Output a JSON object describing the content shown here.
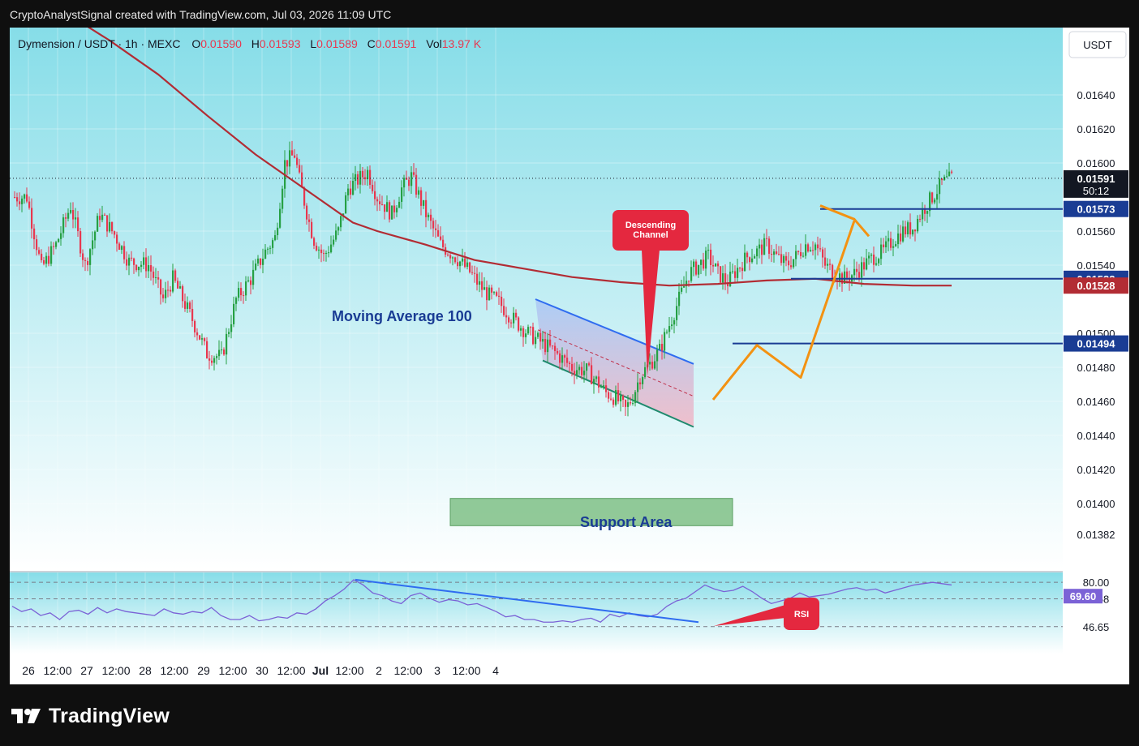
{
  "caption": "CryptoAnalystSignal created with TradingView.com, Jul 03, 2026 11:09 UTC",
  "header": {
    "symbol": "Dymension / USDT · 1h · MEXC",
    "o_label": "O",
    "o_value": "0.01590",
    "h_label": "H",
    "h_value": "0.01593",
    "l_label": "L",
    "l_value": "0.01589",
    "c_label": "C",
    "c_value": "0.01591",
    "vol_label": "Vol",
    "vol_value": "13.97 K"
  },
  "currency_button": "USDT",
  "footer": {
    "brand": "TradingView"
  },
  "colors": {
    "bg_top": "#86dde8",
    "bg_bottom": "#ffffff",
    "up": "#26a044",
    "down": "#e8374f",
    "ma": "#b22c34",
    "level_line": "#1a3c94",
    "orange": "#f39212",
    "channel": "#2f6cf0",
    "channel_fill_top": "#a9c8f6",
    "channel_fill_bottom": "#f2b6c4",
    "support_fill": "#7fbf86",
    "callout": "#e4283f",
    "rsi_line": "#7b62d6"
  },
  "chart_data": {
    "type": "candlestick",
    "pair": "Dymension / USDT",
    "interval": "1h",
    "exchange": "MEXC",
    "price_axis": {
      "min": 0.0137,
      "max": 0.0167,
      "ticks": [
        "0.01640",
        "0.01620",
        "0.01600",
        "0.01560",
        "0.01540",
        "0.01500",
        "0.01480",
        "0.01460",
        "0.01440",
        "0.01420",
        "0.01400",
        "0.01382"
      ]
    },
    "time_axis": {
      "labels": [
        "26",
        "12:00",
        "27",
        "12:00",
        "28",
        "12:00",
        "29",
        "12:00",
        "30",
        "12:00",
        "Jul",
        "12:00",
        "2",
        "12:00",
        "3",
        "12:00",
        "4"
      ],
      "bars_per_label": 12,
      "total_bars": 174
    },
    "close_path": [
      [
        0,
        0.0158
      ],
      [
        6,
        0.0158
      ],
      [
        12,
        0.01538
      ],
      [
        18,
        0.01552
      ],
      [
        24,
        0.01575
      ],
      [
        30,
        0.0154
      ],
      [
        36,
        0.0157
      ],
      [
        42,
        0.01558
      ],
      [
        48,
        0.01542
      ],
      [
        56,
        0.0154
      ],
      [
        62,
        0.0152
      ],
      [
        66,
        0.01532
      ],
      [
        74,
        0.01508
      ],
      [
        80,
        0.01488
      ],
      [
        86,
        0.01486
      ],
      [
        92,
        0.0152
      ],
      [
        98,
        0.01532
      ],
      [
        104,
        0.01548
      ],
      [
        108,
        0.01556
      ],
      [
        112,
        0.016
      ],
      [
        116,
        0.01605
      ],
      [
        118,
        0.0159
      ],
      [
        122,
        0.01565
      ],
      [
        124,
        0.01555
      ],
      [
        128,
        0.01545
      ],
      [
        134,
        0.0156
      ],
      [
        138,
        0.01585
      ],
      [
        142,
        0.0159
      ],
      [
        146,
        0.01595
      ],
      [
        150,
        0.0158
      ],
      [
        156,
        0.0157
      ],
      [
        160,
        0.01585
      ],
      [
        164,
        0.01592
      ],
      [
        170,
        0.0157
      ],
      [
        176,
        0.01552
      ],
      [
        182,
        0.01545
      ],
      [
        188,
        0.01536
      ],
      [
        192,
        0.01528
      ],
      [
        196,
        0.01522
      ],
      [
        200,
        0.01518
      ],
      [
        206,
        0.01508
      ],
      [
        212,
        0.015
      ],
      [
        216,
        0.01496
      ],
      [
        222,
        0.0149
      ],
      [
        226,
        0.01485
      ],
      [
        230,
        0.0148
      ],
      [
        236,
        0.01478
      ],
      [
        240,
        0.01472
      ],
      [
        244,
        0.01465
      ],
      [
        248,
        0.01462
      ],
      [
        252,
        0.01455
      ],
      [
        255,
        0.01463
      ],
      [
        258,
        0.01475
      ],
      [
        262,
        0.01482
      ],
      [
        266,
        0.0149
      ],
      [
        270,
        0.01505
      ],
      [
        274,
        0.0152
      ],
      [
        278,
        0.01535
      ],
      [
        282,
        0.0154
      ],
      [
        286,
        0.01545
      ],
      [
        290,
        0.01535
      ],
      [
        294,
        0.0153
      ],
      [
        298,
        0.01538
      ],
      [
        302,
        0.01545
      ],
      [
        306,
        0.01548
      ],
      [
        310,
        0.01552
      ],
      [
        314,
        0.01545
      ],
      [
        318,
        0.0154
      ],
      [
        322,
        0.01545
      ],
      [
        326,
        0.01552
      ],
      [
        330,
        0.01552
      ],
      [
        334,
        0.0154
      ],
      [
        338,
        0.01535
      ],
      [
        342,
        0.01532
      ],
      [
        346,
        0.01535
      ],
      [
        350,
        0.0154
      ],
      [
        354,
        0.01545
      ],
      [
        358,
        0.01548
      ],
      [
        362,
        0.01555
      ],
      [
        366,
        0.0156
      ],
      [
        370,
        0.01562
      ],
      [
        374,
        0.01572
      ],
      [
        378,
        0.0158
      ],
      [
        382,
        0.01588
      ],
      [
        386,
        0.01591
      ]
    ],
    "moving_average_100_path": [
      [
        0,
        0.01695
      ],
      [
        20,
        0.0169
      ],
      [
        40,
        0.01672
      ],
      [
        60,
        0.01652
      ],
      [
        80,
        0.01628
      ],
      [
        100,
        0.01605
      ],
      [
        120,
        0.01585
      ],
      [
        140,
        0.01565
      ],
      [
        150,
        0.0156
      ],
      [
        170,
        0.01552
      ],
      [
        190,
        0.01543
      ],
      [
        210,
        0.01538
      ],
      [
        230,
        0.01533
      ],
      [
        250,
        0.0153
      ],
      [
        270,
        0.01528
      ],
      [
        290,
        0.01529
      ],
      [
        310,
        0.01531
      ],
      [
        330,
        0.01532
      ],
      [
        350,
        0.01529
      ],
      [
        370,
        0.01528
      ],
      [
        386,
        0.01528
      ]
    ],
    "price_labels": [
      {
        "value": "0.01591",
        "sub": "50:12",
        "kind": "last"
      },
      {
        "value": "0.01573",
        "kind": "level"
      },
      {
        "value": "0.01532",
        "kind": "level"
      },
      {
        "value": "0.01528",
        "kind": "ma"
      },
      {
        "value": "0.01494",
        "kind": "level"
      }
    ],
    "horizontal_levels": [
      {
        "price": 0.01573,
        "from_bar": 332,
        "label_value": "0.01573"
      },
      {
        "price": 0.01532,
        "from_bar": 320,
        "label_value": "0.01532"
      },
      {
        "price": 0.01494,
        "from_bar": 296,
        "label_value": "0.01494"
      }
    ],
    "annotations": {
      "moving_average_label": "Moving Average 100",
      "descending_channel_label": "Descending Channel",
      "support_label": "Support Area",
      "rsi_label": "RSI",
      "support_zone": {
        "price_top": 0.01403,
        "price_bottom": 0.01387,
        "from_bar": 180,
        "to_bar": 296
      },
      "descending_channel": {
        "upper": [
          [
            215,
            0.0152
          ],
          [
            280,
            0.01482
          ]
        ],
        "lower": [
          [
            218,
            0.01484
          ],
          [
            280,
            0.01445
          ]
        ],
        "mid": [
          [
            216,
            0.01502
          ],
          [
            280,
            0.01463
          ]
        ]
      },
      "orange_path_bars": [
        [
          288,
          0.01461
        ],
        [
          306,
          0.01493
        ],
        [
          324,
          0.01474
        ],
        [
          346,
          0.01566
        ]
      ],
      "orange_arrow_head": [
        [
          332,
          0.01575
        ],
        [
          346,
          0.01567
        ],
        [
          352,
          0.01557
        ]
      ]
    },
    "rsi": {
      "levels": [
        "80.00",
        "67.58",
        "46.65"
      ],
      "current": "69.60",
      "values": [
        62,
        58,
        60,
        55,
        57,
        52,
        58,
        59,
        56,
        61,
        57,
        60,
        58,
        57,
        56,
        55,
        60,
        57,
        56,
        58,
        57,
        61,
        55,
        52,
        52,
        55,
        51,
        52,
        54,
        53,
        57,
        56,
        60,
        66,
        70,
        75,
        82,
        78,
        72,
        70,
        66,
        64,
        70,
        72,
        68,
        65,
        67,
        66,
        63,
        64,
        61,
        58,
        54,
        55,
        52,
        52,
        50,
        50,
        51,
        50,
        52,
        53,
        50,
        56,
        54,
        57,
        55,
        54,
        56,
        62,
        66,
        68,
        73,
        78,
        75,
        73,
        74,
        77,
        73,
        68,
        64,
        66,
        68,
        72,
        69,
        70,
        71,
        73,
        75,
        76,
        74,
        75,
        72,
        74,
        76,
        78,
        79,
        80,
        79,
        78
      ]
    }
  }
}
